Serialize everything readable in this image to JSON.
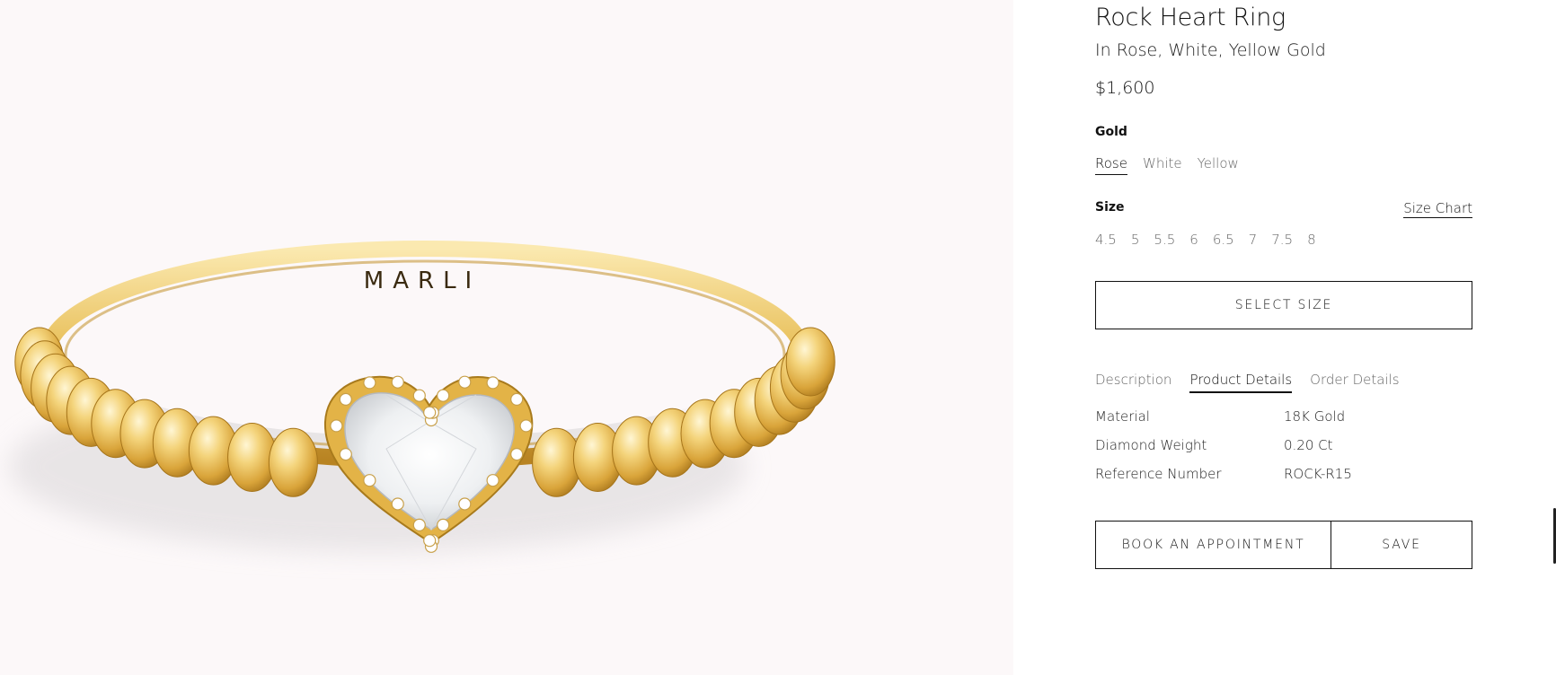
{
  "product": {
    "image_alt": "Rock Heart Ring",
    "engraving": "MARLI",
    "title": "Rock Heart Ring",
    "subtitle": "In Rose, White, Yellow Gold",
    "price": "$1,600"
  },
  "gold": {
    "label": "Gold",
    "options": [
      "Rose",
      "White",
      "Yellow"
    ],
    "selected": "Rose"
  },
  "size": {
    "label": "Size",
    "chart_link": "Size Chart",
    "options": [
      "4.5",
      "5",
      "5.5",
      "6",
      "6.5",
      "7",
      "7.5",
      "8"
    ]
  },
  "buttons": {
    "select_size": "SELECT SIZE",
    "book": "BOOK AN APPOINTMENT",
    "save": "SAVE"
  },
  "tabs": {
    "items": [
      "Description",
      "Product Details",
      "Order Details"
    ],
    "active": "Product Details"
  },
  "specs": [
    {
      "label": "Material",
      "value": "18K Gold"
    },
    {
      "label": "Diamond Weight",
      "value": "0.20 Ct"
    },
    {
      "label": "Reference Number",
      "value": "ROCK-R15"
    }
  ],
  "colors": {
    "image_background": "#fcf8f9",
    "gold_light": "#f6dc8a",
    "gold_mid": "#e4b448",
    "gold_dark": "#b07c18",
    "text": "#111111",
    "muted_text": "#666666"
  }
}
